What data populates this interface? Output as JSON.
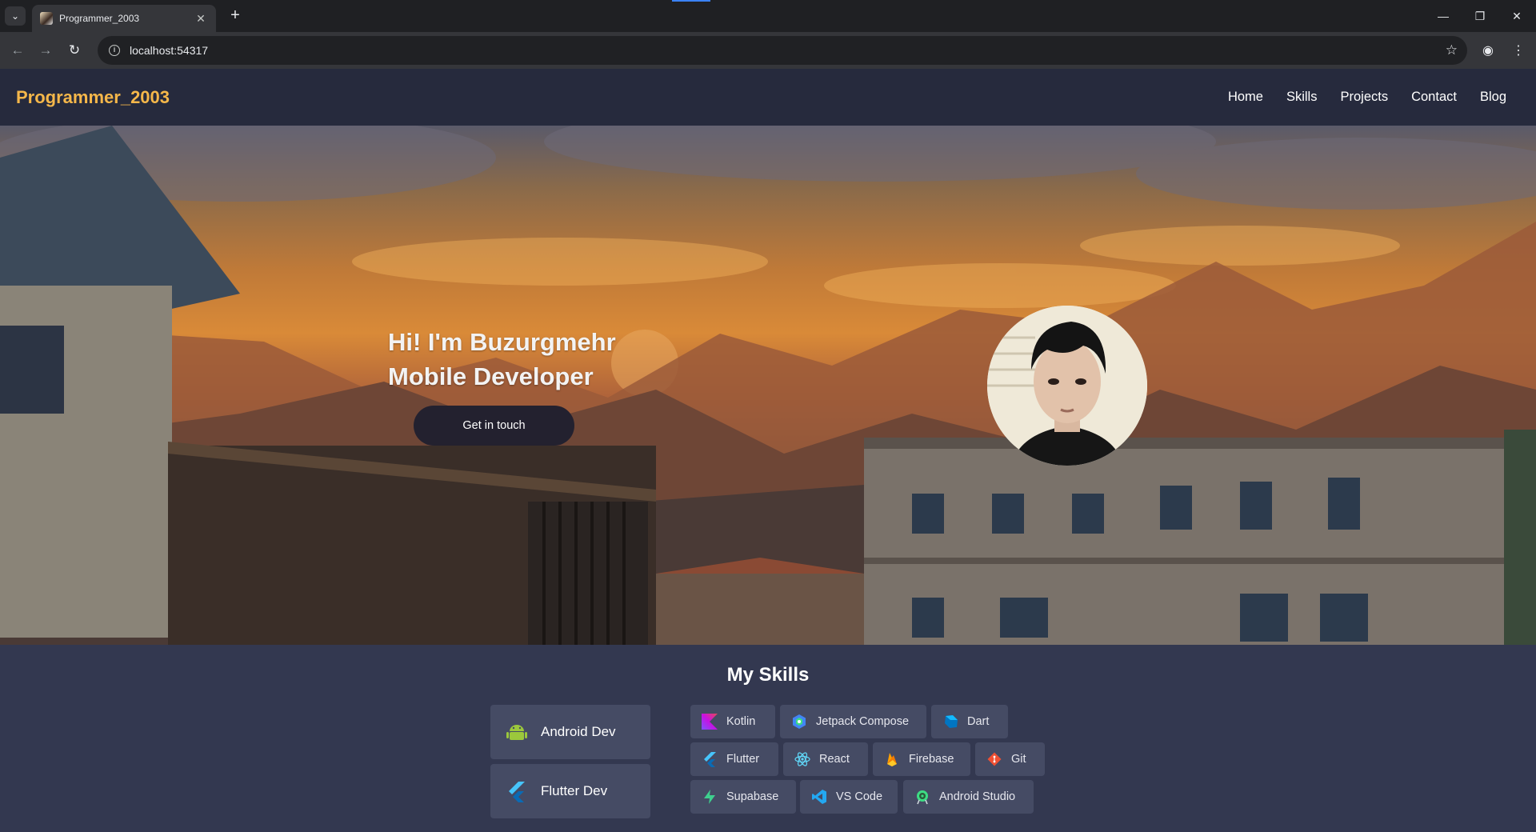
{
  "browser": {
    "tab_title": "Programmer_2003",
    "url": "localhost:54317"
  },
  "site": {
    "brand": "Programmer_2003",
    "nav": [
      "Home",
      "Skills",
      "Projects",
      "Contact",
      "Blog"
    ]
  },
  "hero": {
    "line1": "Hi! I'm Buzurgmehr",
    "line2": "Mobile Developer",
    "cta": "Get in touch"
  },
  "skills": {
    "title": "My Skills",
    "categories": [
      "Android Dev",
      "Flutter Dev"
    ],
    "chips": [
      "Kotlin",
      "Jetpack Compose",
      "Dart",
      "Flutter",
      "React",
      "Firebase",
      "Git",
      "Supabase",
      "VS Code",
      "Android Studio"
    ]
  },
  "colors": {
    "brand": "#f5b74a",
    "header_bg": "#262a3d",
    "skills_bg": "#333850",
    "card_bg": "#454b64",
    "cta_bg": "#23212f"
  }
}
